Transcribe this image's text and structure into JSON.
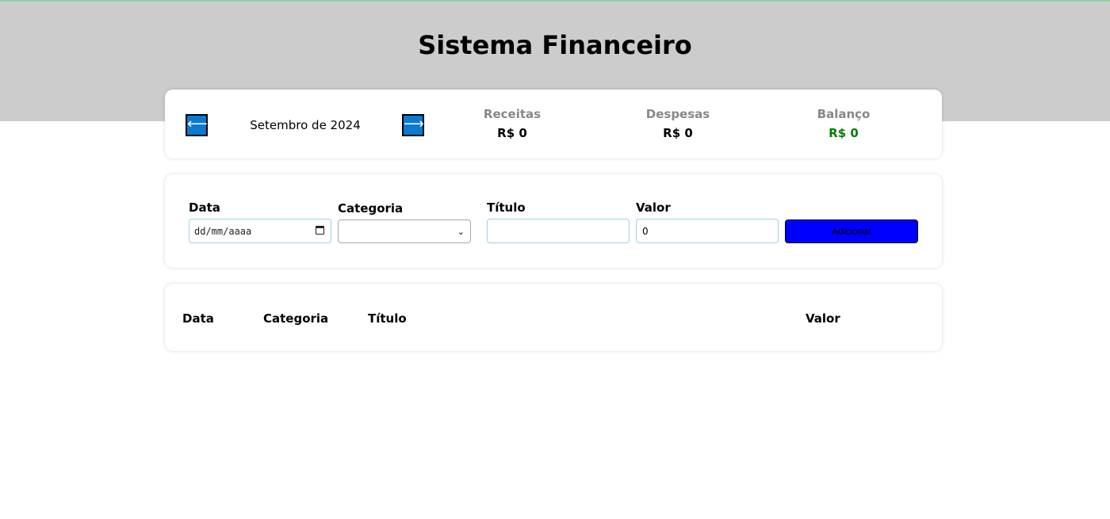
{
  "header": {
    "title": "Sistema Financeiro"
  },
  "period": {
    "prev_icon": "arrow-left-icon",
    "next_icon": "arrow-right-icon",
    "prev_glyph": "⟵",
    "next_glyph": "⟶",
    "label": "Setembro de 2024"
  },
  "summary": {
    "receitas": {
      "label": "Receitas",
      "value": "R$ 0"
    },
    "despesas": {
      "label": "Despesas",
      "value": "R$ 0"
    },
    "balanco": {
      "label": "Balanço",
      "value": "R$ 0",
      "color": "#008000"
    }
  },
  "form": {
    "date": {
      "label": "Data",
      "placeholder": "dd/mm/aaaa"
    },
    "category": {
      "label": "Categoria",
      "value": ""
    },
    "title": {
      "label": "Título",
      "value": ""
    },
    "value": {
      "label": "Valor",
      "value": "0"
    },
    "add_button": "Adicionar",
    "add_button_color": "#0000ff"
  },
  "table": {
    "columns": [
      "Data",
      "Categoria",
      "Título",
      "Valor"
    ]
  },
  "colors": {
    "header_bg": "#cccccc",
    "arrow_bg": "#0a7ad1"
  }
}
